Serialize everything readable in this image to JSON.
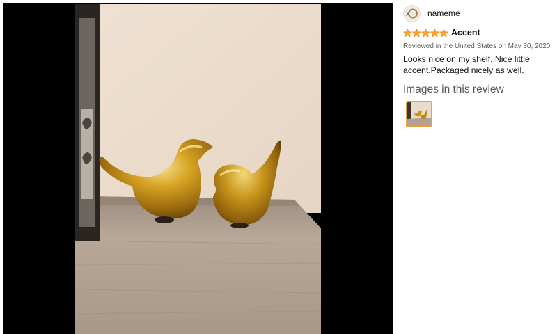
{
  "reviewer": {
    "name": "nameme",
    "avatar_icon": "avatar-icon"
  },
  "review": {
    "rating": 5,
    "rating_max": 5,
    "title": "Accent",
    "date": "Reviewed in the United States on May 30, 2020",
    "body": "Looks nice on my shelf. Nice little accent.Packaged nicely as well."
  },
  "images_section": {
    "heading": "Images in this review"
  },
  "colors": {
    "star": "#ffa41c",
    "thumb_border": "#e8a43b",
    "viewer_bg": "#000000",
    "muted_text": "#565959"
  }
}
